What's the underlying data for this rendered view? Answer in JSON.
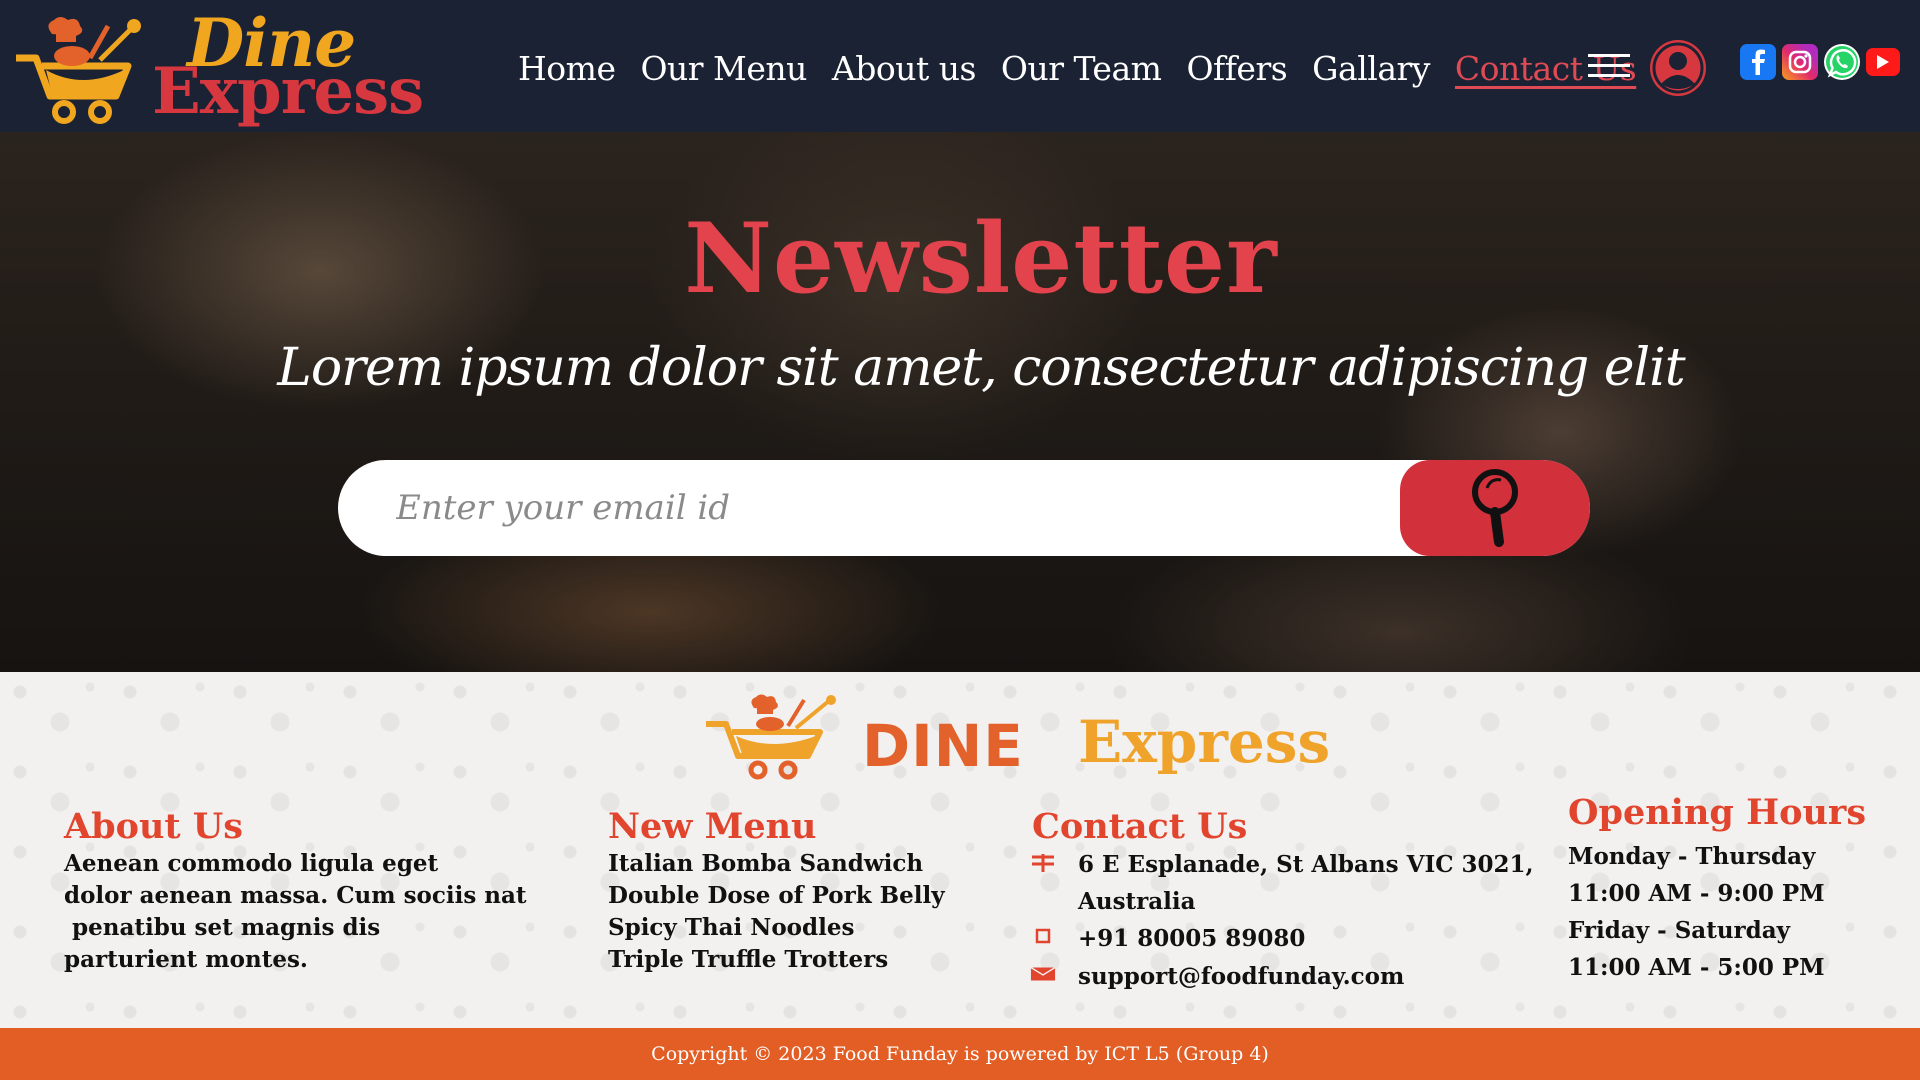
{
  "brand": {
    "logo_line1": "Dine",
    "logo_line2": "Express",
    "icon": "chef-cart-logo-icon"
  },
  "nav": {
    "items": [
      {
        "label": "Home"
      },
      {
        "label": "Our Menu"
      },
      {
        "label": "About us"
      },
      {
        "label": "Our Team"
      },
      {
        "label": "Offers"
      },
      {
        "label": "Gallary"
      },
      {
        "label": "Contact Us",
        "active": true
      }
    ],
    "menu_icon": "hamburger-icon",
    "user_icon": "user-icon"
  },
  "socials": [
    {
      "name": "facebook-icon",
      "color": "#1877f2"
    },
    {
      "name": "instagram-icon",
      "color": "#e12b6b"
    },
    {
      "name": "whatsapp-icon",
      "color": "#25d366"
    },
    {
      "name": "youtube-icon",
      "color": "#ff1a1a"
    }
  ],
  "hero": {
    "title": "Newsletter",
    "subtitle": "Lorem ipsum dolor sit amet, consectetur adipiscing elit",
    "email_placeholder": "Enter your email id",
    "search_icon": "search-icon"
  },
  "footer": {
    "logo_dine": "DINE",
    "logo_express": "Express",
    "about": {
      "title": "About Us",
      "lines": [
        "Aenean commodo ligula eget",
        "dolor aenean massa. Cum sociis nat",
        " penatibu set magnis dis",
        "parturient montes."
      ]
    },
    "new_menu": {
      "title": "New Menu",
      "items": [
        "Italian Bomba Sandwich",
        "Double Dose of Pork Belly",
        "Spicy Thai Noodles",
        "Triple Truffle Trotters"
      ]
    },
    "contact": {
      "title": "Contact Us",
      "address_line1": "6 E Esplanade, St Albans VIC 3021,",
      "address_line2": "Australia",
      "phone": "+91 80005 89080",
      "email": "support@foodfunday.com"
    },
    "hours": {
      "title": "Opening Hours",
      "rows": [
        "Monday - Thursday",
        "11:00 AM - 9:00 PM",
        "Friday - Saturday",
        "11:00 AM - 5:00 PM"
      ]
    }
  },
  "copyright": "Copyright © 2023 Food Funday is powered by ICT L5 (Group 4)",
  "colors": {
    "header_bg": "#1b2233",
    "accent_red": "#d7373f",
    "accent_orange": "#e25e25",
    "accent_gold": "#f0a61f"
  }
}
